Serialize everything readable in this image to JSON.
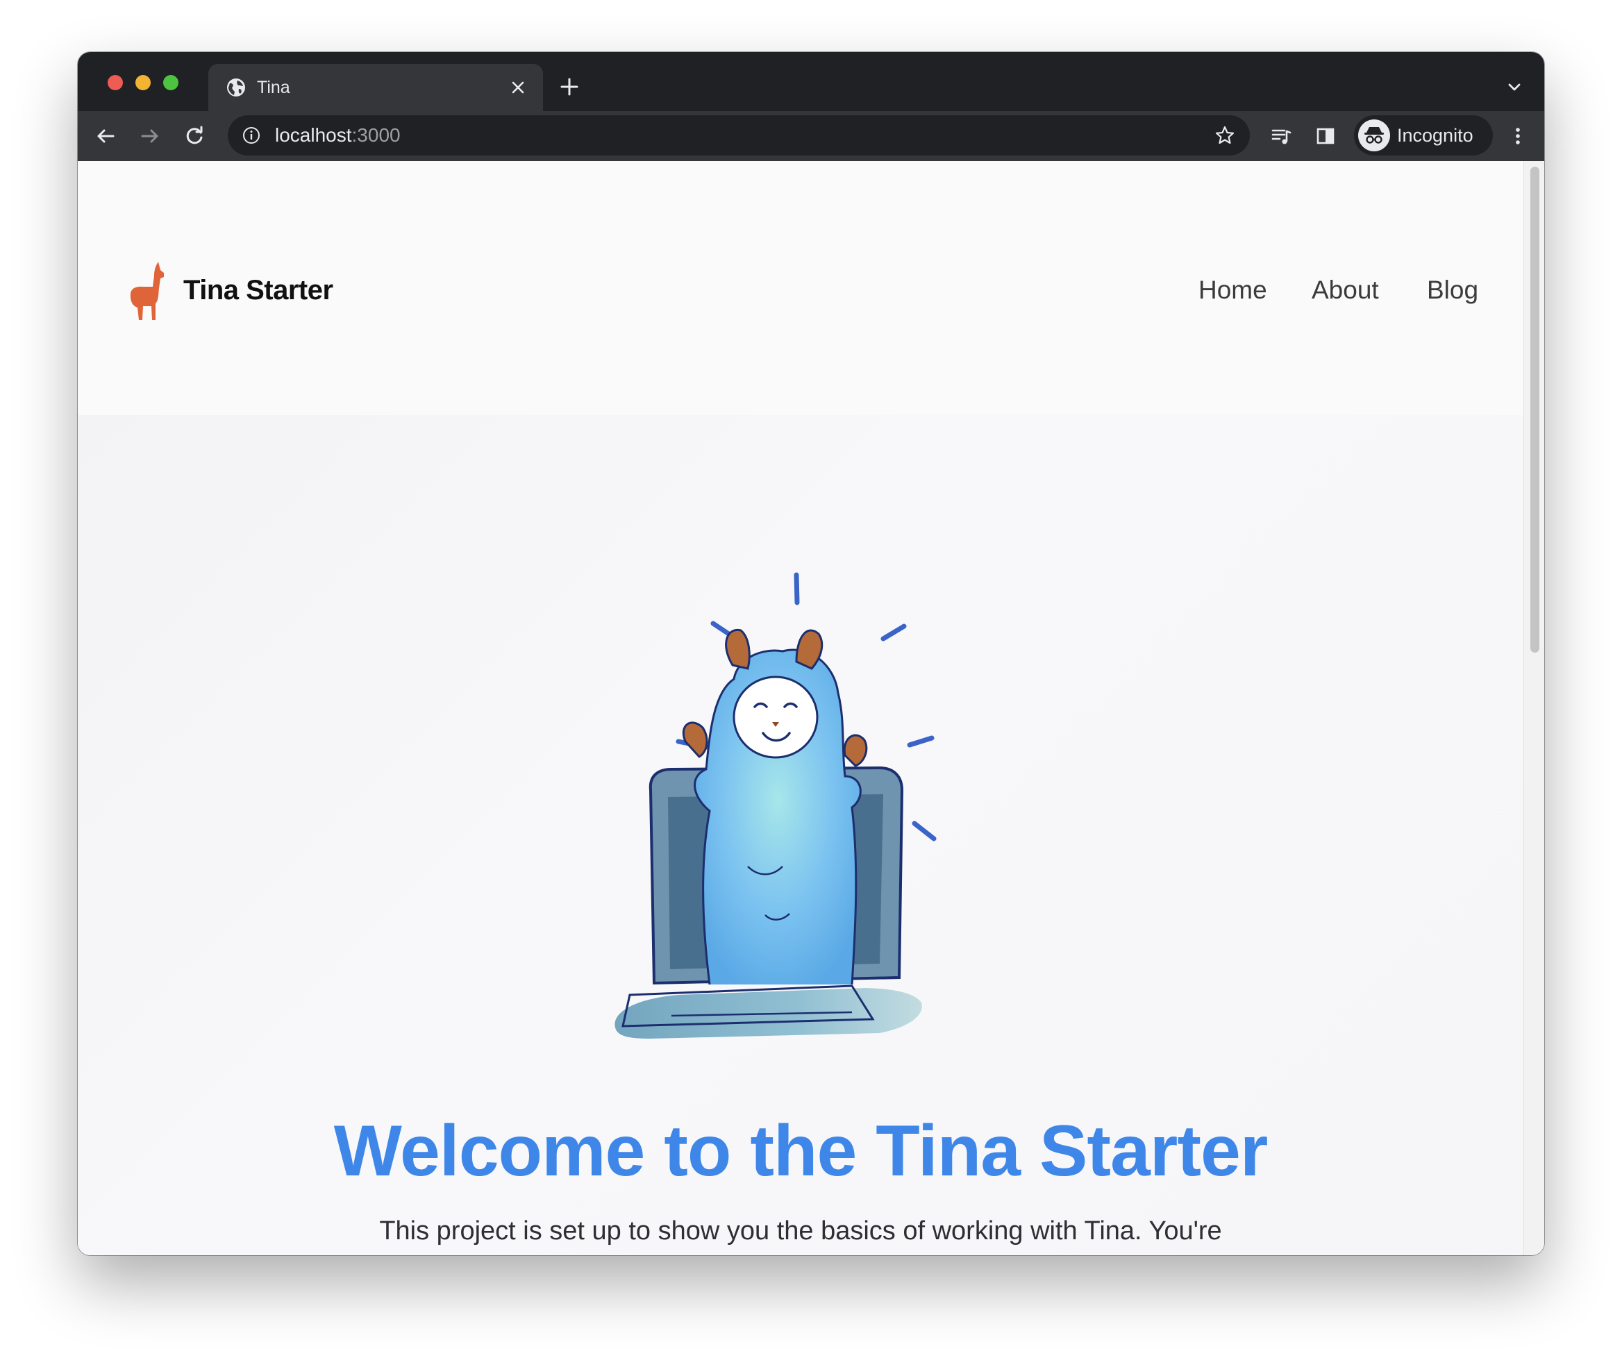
{
  "browser": {
    "tab_title": "Tina",
    "url_host": "localhost",
    "url_port": ":3000",
    "profile_label": "Incognito"
  },
  "site": {
    "brand": "Tina Starter",
    "nav": [
      {
        "label": "Home"
      },
      {
        "label": "About"
      },
      {
        "label": "Blog"
      }
    ]
  },
  "hero": {
    "title": "Welcome to the Tina Starter",
    "body": "This project is set up to show you the basics of working with Tina. You're"
  },
  "colors": {
    "accent": "#3e87e8",
    "logo": "#e0643a"
  },
  "icons": [
    "globe-icon",
    "close-icon",
    "plus-icon",
    "chevron-down-icon",
    "back-arrow-icon",
    "forward-arrow-icon",
    "reload-icon",
    "info-icon",
    "star-icon",
    "media-control-icon",
    "side-panel-icon",
    "incognito-icon",
    "more-vert-icon",
    "llama-logo-icon"
  ]
}
